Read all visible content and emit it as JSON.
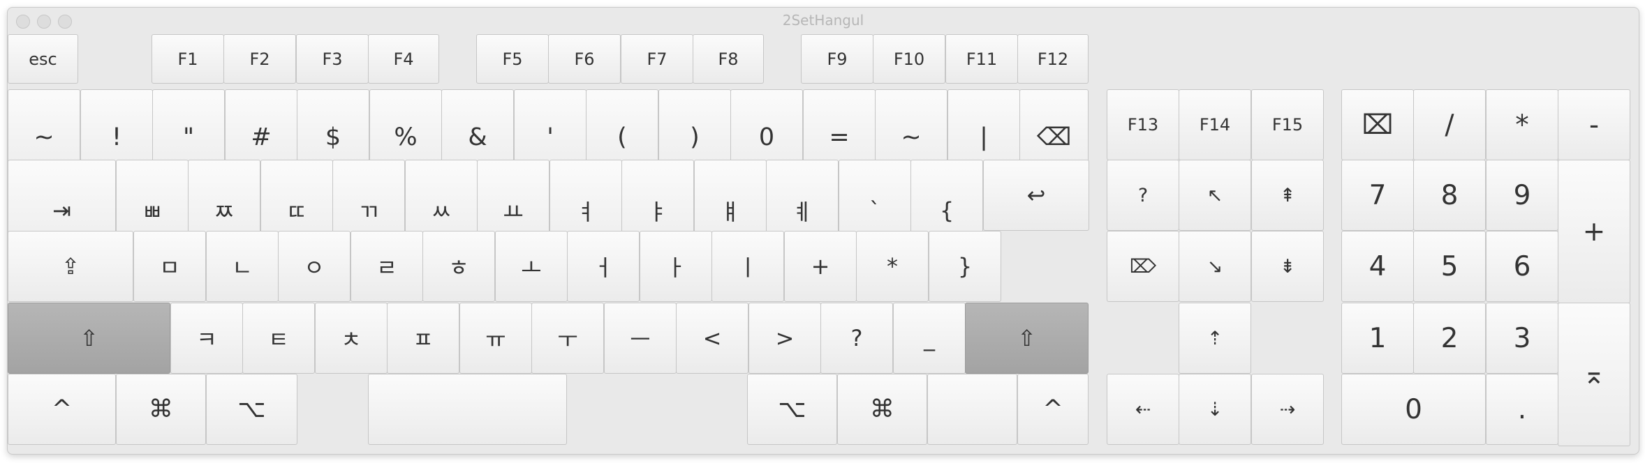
{
  "window": {
    "title": "2SetHangul"
  },
  "keyboard": {
    "function_row": [
      {
        "name": "esc-key",
        "label": "esc"
      },
      {
        "name": "f1-key",
        "label": "F1"
      },
      {
        "name": "f2-key",
        "label": "F2"
      },
      {
        "name": "f3-key",
        "label": "F3"
      },
      {
        "name": "f4-key",
        "label": "F4"
      },
      {
        "name": "f5-key",
        "label": "F5"
      },
      {
        "name": "f6-key",
        "label": "F6"
      },
      {
        "name": "f7-key",
        "label": "F7"
      },
      {
        "name": "f8-key",
        "label": "F8"
      },
      {
        "name": "f9-key",
        "label": "F9"
      },
      {
        "name": "f10-key",
        "label": "F10"
      },
      {
        "name": "f11-key",
        "label": "F11"
      },
      {
        "name": "f12-key",
        "label": "F12"
      }
    ],
    "number_row": [
      {
        "name": "tilde-key",
        "label": "~"
      },
      {
        "name": "exclamation-key",
        "label": "!"
      },
      {
        "name": "double-quote-key",
        "label": "\""
      },
      {
        "name": "hash-key",
        "label": "#"
      },
      {
        "name": "dollar-key",
        "label": "$"
      },
      {
        "name": "percent-key",
        "label": "%"
      },
      {
        "name": "ampersand-key",
        "label": "&"
      },
      {
        "name": "apostrophe-key",
        "label": "'"
      },
      {
        "name": "left-paren-key",
        "label": "("
      },
      {
        "name": "right-paren-key",
        "label": ")"
      },
      {
        "name": "zero-key",
        "label": "0"
      },
      {
        "name": "equals-key",
        "label": "="
      },
      {
        "name": "tilde-right-key",
        "label": "~"
      },
      {
        "name": "pipe-key",
        "label": "|"
      },
      {
        "name": "delete-key",
        "label": "⌫",
        "icon": "delete-left-icon"
      }
    ],
    "top_row": [
      {
        "name": "tab-key",
        "label": "⇥",
        "icon": "tab-icon"
      },
      {
        "name": "ssangbieup-key",
        "label": "ㅃ"
      },
      {
        "name": "ssangjieut-key",
        "label": "ㅉ"
      },
      {
        "name": "ssangdigeut-key",
        "label": "ㄸ"
      },
      {
        "name": "ssanggiyeok-key",
        "label": "ㄲ"
      },
      {
        "name": "ssangsiot-key",
        "label": "ㅆ"
      },
      {
        "name": "yo-key",
        "label": "ㅛ"
      },
      {
        "name": "yeo-key",
        "label": "ㅕ"
      },
      {
        "name": "ya-key",
        "label": "ㅑ"
      },
      {
        "name": "yae-key",
        "label": "ㅒ"
      },
      {
        "name": "ye-key",
        "label": "ㅖ"
      },
      {
        "name": "backtick-key",
        "label": "`"
      },
      {
        "name": "left-brace-key",
        "label": "{"
      },
      {
        "name": "return-key",
        "label": "↩",
        "icon": "return-icon"
      }
    ],
    "home_row": [
      {
        "name": "caps-lock-key",
        "label": "⇪",
        "icon": "caps-lock-icon"
      },
      {
        "name": "mieum-key",
        "label": "ㅁ"
      },
      {
        "name": "nieun-key",
        "label": "ㄴ"
      },
      {
        "name": "ieung-key",
        "label": "ㅇ"
      },
      {
        "name": "rieul-key",
        "label": "ㄹ"
      },
      {
        "name": "hieut-key",
        "label": "ㅎ"
      },
      {
        "name": "o-key",
        "label": "ㅗ"
      },
      {
        "name": "eo-key",
        "label": "ㅓ"
      },
      {
        "name": "a-key",
        "label": "ㅏ"
      },
      {
        "name": "i-key",
        "label": "ㅣ"
      },
      {
        "name": "plus-key",
        "label": "+"
      },
      {
        "name": "asterisk-key",
        "label": "*"
      },
      {
        "name": "right-brace-key",
        "label": "}"
      }
    ],
    "bottom_row": [
      {
        "name": "left-shift-key",
        "label": "⇧",
        "icon": "shift-icon"
      },
      {
        "name": "kieuk-key",
        "label": "ㅋ"
      },
      {
        "name": "tieut-key",
        "label": "ㅌ"
      },
      {
        "name": "chieut-key",
        "label": "ㅊ"
      },
      {
        "name": "pieup-key",
        "label": "ㅍ"
      },
      {
        "name": "yu-key",
        "label": "ㅠ"
      },
      {
        "name": "u-key",
        "label": "ㅜ"
      },
      {
        "name": "eu-key",
        "label": "ㅡ"
      },
      {
        "name": "less-than-key",
        "label": "<"
      },
      {
        "name": "greater-than-key",
        "label": ">"
      },
      {
        "name": "question-key",
        "label": "?"
      },
      {
        "name": "underscore-key",
        "label": "_"
      },
      {
        "name": "right-shift-key",
        "label": "⇧",
        "icon": "shift-icon"
      }
    ],
    "modifier_row": [
      {
        "name": "left-control-key",
        "label": "^",
        "icon": "control-icon"
      },
      {
        "name": "left-command-key",
        "label": "⌘",
        "icon": "command-icon"
      },
      {
        "name": "left-option-key",
        "label": "⌥",
        "icon": "option-icon"
      },
      {
        "name": "space-key",
        "label": ""
      },
      {
        "name": "right-option-key",
        "label": "⌥",
        "icon": "option-icon"
      },
      {
        "name": "right-command-key",
        "label": "⌘",
        "icon": "command-icon"
      },
      {
        "name": "right-fn-key",
        "label": ""
      },
      {
        "name": "right-control-key",
        "label": "^",
        "icon": "control-icon"
      }
    ],
    "nav_cluster": [
      {
        "name": "f13-key",
        "label": "F13"
      },
      {
        "name": "f14-key",
        "label": "F14"
      },
      {
        "name": "f15-key",
        "label": "F15"
      },
      {
        "name": "help-key",
        "label": "?",
        "icon": "help-circle-icon"
      },
      {
        "name": "home-key",
        "label": "↖",
        "icon": "home-arrow-icon"
      },
      {
        "name": "page-up-key",
        "label": "⇞",
        "icon": "page-up-icon"
      },
      {
        "name": "forward-delete-key",
        "label": "⌦",
        "icon": "delete-right-icon"
      },
      {
        "name": "end-key",
        "label": "↘",
        "icon": "end-arrow-icon"
      },
      {
        "name": "page-down-key",
        "label": "⇟",
        "icon": "page-down-icon"
      },
      {
        "name": "up-arrow-key",
        "label": "⇡",
        "icon": "up-arrow-icon"
      },
      {
        "name": "left-arrow-key",
        "label": "⇠",
        "icon": "left-arrow-icon"
      },
      {
        "name": "down-arrow-key",
        "label": "⇣",
        "icon": "down-arrow-icon"
      },
      {
        "name": "right-arrow-key",
        "label": "⇢",
        "icon": "right-arrow-icon"
      }
    ],
    "numpad": [
      {
        "name": "numpad-clear-key",
        "label": "⌧",
        "icon": "clear-icon"
      },
      {
        "name": "numpad-slash-key",
        "label": "/"
      },
      {
        "name": "numpad-asterisk-key",
        "label": "*"
      },
      {
        "name": "numpad-minus-key",
        "label": "-"
      },
      {
        "name": "numpad-7-key",
        "label": "7"
      },
      {
        "name": "numpad-8-key",
        "label": "8"
      },
      {
        "name": "numpad-9-key",
        "label": "9"
      },
      {
        "name": "numpad-plus-key",
        "label": "+"
      },
      {
        "name": "numpad-4-key",
        "label": "4"
      },
      {
        "name": "numpad-5-key",
        "label": "5"
      },
      {
        "name": "numpad-6-key",
        "label": "6"
      },
      {
        "name": "numpad-1-key",
        "label": "1"
      },
      {
        "name": "numpad-2-key",
        "label": "2"
      },
      {
        "name": "numpad-3-key",
        "label": "3"
      },
      {
        "name": "numpad-enter-key",
        "label": "⌅",
        "icon": "enter-icon"
      },
      {
        "name": "numpad-0-key",
        "label": "0"
      },
      {
        "name": "numpad-period-key",
        "label": "."
      }
    ]
  }
}
